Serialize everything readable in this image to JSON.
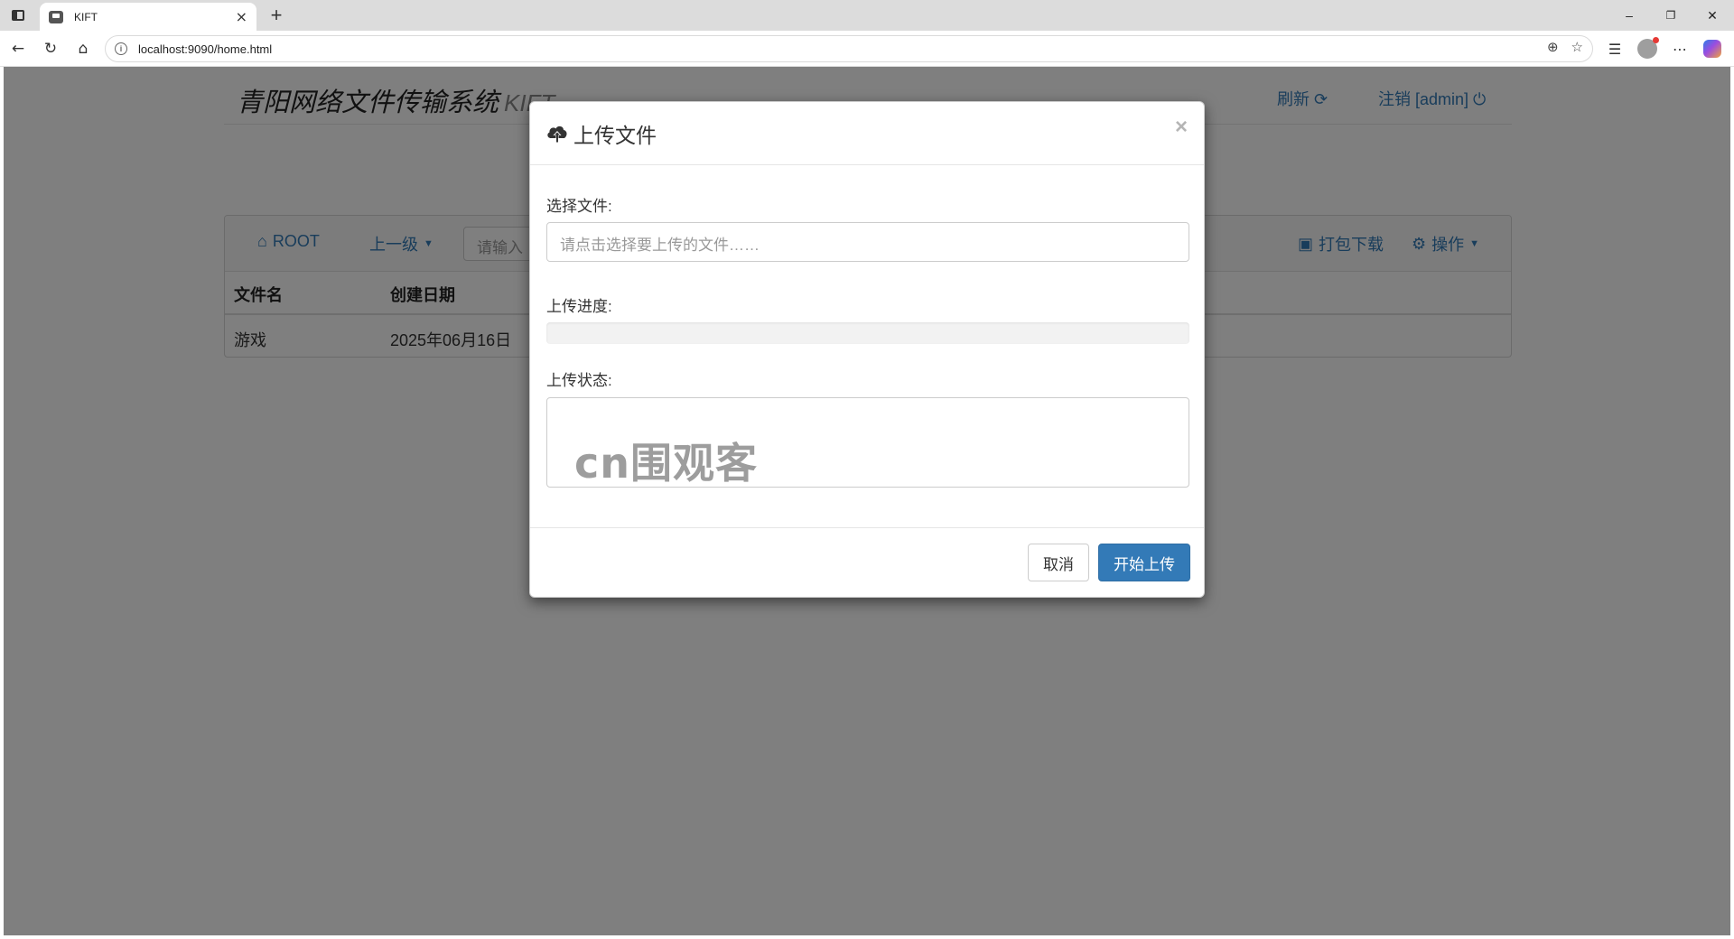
{
  "browser": {
    "tab_title": "KIFT",
    "tab_close": "×",
    "new_tab": "+",
    "url": "localhost:9090/home.html",
    "win_minimize": "–",
    "win_restore": "❐",
    "win_close": "✕"
  },
  "header": {
    "brand": "青阳网络文件传输系统",
    "brand_sub": "KIFT",
    "refresh_label": "刷新",
    "logout_label": "注销 [admin]"
  },
  "nav": {
    "root_label": "ROOT",
    "parent_label": "上一级",
    "search_placeholder": "请输入",
    "pack_download_label": "打包下载",
    "operations_label": "操作"
  },
  "table": {
    "headers": [
      "文件名",
      "创建日期"
    ],
    "rows": [
      {
        "name": "游戏",
        "created": "2025年06月16日"
      }
    ]
  },
  "modal": {
    "title": "上传文件",
    "close": "×",
    "select_file_label": "选择文件:",
    "file_placeholder": "请点击选择要上传的文件……",
    "progress_label": "上传进度:",
    "progress_value": 0,
    "status_label": "上传状态:",
    "watermark": "cn围观客www.weiguanke.cn",
    "cancel_label": "取消",
    "start_label": "开始上传"
  },
  "colors": {
    "link": "#337ab7",
    "primary": "#337ab7",
    "backdrop": "rgba(0,0,0,0.5)"
  }
}
